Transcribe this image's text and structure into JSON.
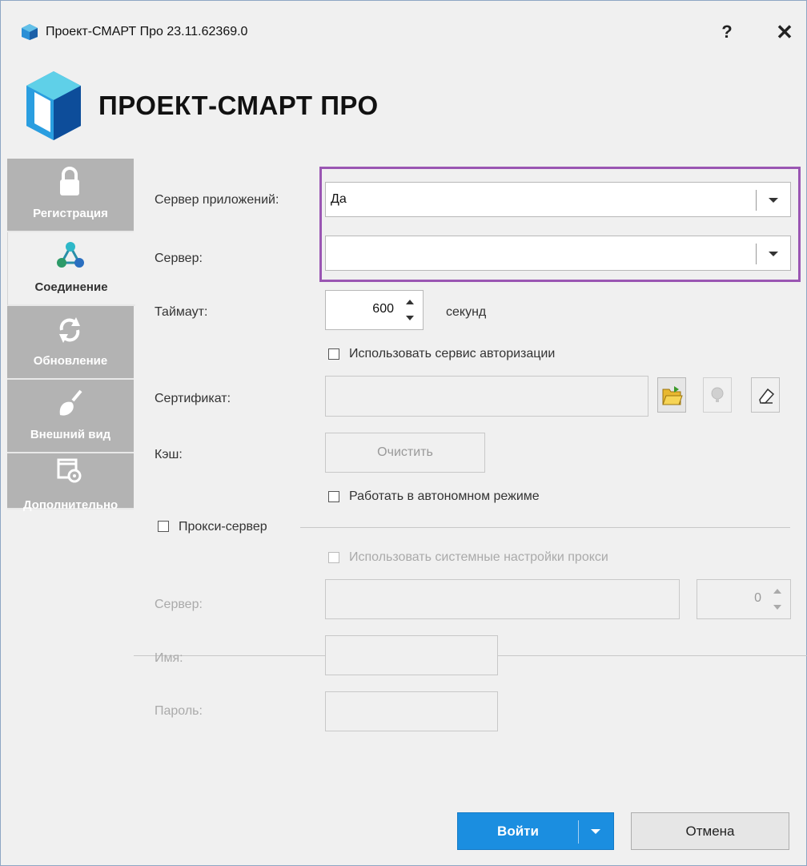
{
  "window": {
    "title": "Проект-СМАРТ Про 23.11.62369.0",
    "help_label": "?",
    "close_label": "✕"
  },
  "header": {
    "logo_text": "ПРОЕКТ-СМАРТ ПРО"
  },
  "sidebar": {
    "items": [
      {
        "label": "Регистрация",
        "icon": "lock-icon",
        "active": false
      },
      {
        "label": "Соединение",
        "icon": "network-icon",
        "active": true
      },
      {
        "label": "Обновление",
        "icon": "refresh-icon",
        "active": false
      },
      {
        "label": "Внешний вид",
        "icon": "brush-icon",
        "active": false
      },
      {
        "label": "Дополнительно",
        "icon": "window-settings-icon",
        "active": false
      }
    ]
  },
  "form": {
    "app_server": {
      "label": "Сервер приложений:",
      "value": "Да"
    },
    "server": {
      "label": "Сервер:",
      "value": ""
    },
    "timeout": {
      "label": "Таймаут:",
      "value": "600",
      "unit": "секунд"
    },
    "use_auth_service": {
      "label": "Использовать сервис авторизации",
      "checked": false
    },
    "certificate": {
      "label": "Сертификат:",
      "value": ""
    },
    "cache": {
      "label": "Кэш:",
      "clear_label": "Очистить"
    },
    "offline_mode": {
      "label": "Работать в автономном режиме",
      "checked": false
    },
    "proxy": {
      "label": "Прокси-сервер",
      "checked": false,
      "use_system": {
        "label": "Использовать системные настройки прокси",
        "checked": false
      },
      "server": {
        "label": "Сервер:",
        "value": "",
        "port": "0"
      },
      "name": {
        "label": "Имя:",
        "value": ""
      },
      "password": {
        "label": "Пароль:",
        "value": ""
      }
    }
  },
  "footer": {
    "login_label": "Войти",
    "cancel_label": "Отмена"
  },
  "colors": {
    "accent": "#1b8ee0",
    "highlight": "#9a56b3",
    "sidebar_bg": "#b3b3b3"
  }
}
